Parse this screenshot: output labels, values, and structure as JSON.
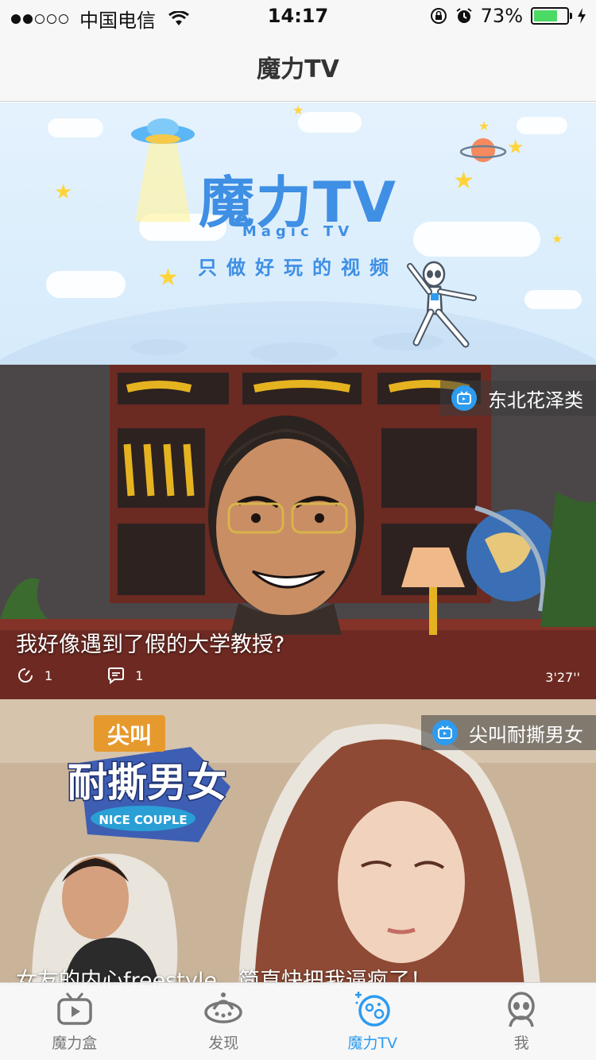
{
  "status_bar": {
    "carrier": "中国电信",
    "time": "14:17",
    "battery_percent": "73%",
    "battery_level": 0.73,
    "signal_bars_filled": 2,
    "signal_bars_total": 5
  },
  "nav": {
    "title": "魔力TV"
  },
  "banner": {
    "logo_text": "魔力TV",
    "sub_text": "Magic TV",
    "slogan": "只做好玩的视频"
  },
  "videos": [
    {
      "channel": "东北花泽类",
      "title": "我好像遇到了假的大学教授?",
      "plays": "1",
      "comments": "1",
      "duration": "3'27''"
    },
    {
      "channel": "尖叫耐撕男女",
      "title": "女友的内心freestyle，简直快把我逼疯了！",
      "show_logo_top": "尖叫",
      "show_logo_main": "耐撕男女",
      "show_logo_en": "NICE COUPLE"
    }
  ],
  "tabs": [
    {
      "label": "魔力盒",
      "icon": "tv-box-icon",
      "active": false
    },
    {
      "label": "发现",
      "icon": "ufo-icon",
      "active": false
    },
    {
      "label": "魔力TV",
      "icon": "planet-icon",
      "active": true
    },
    {
      "label": "我",
      "icon": "alien-icon",
      "active": false
    }
  ],
  "colors": {
    "accent": "#2d9bf0",
    "battery": "#4cd964",
    "banner_text": "#3f8fe4"
  }
}
